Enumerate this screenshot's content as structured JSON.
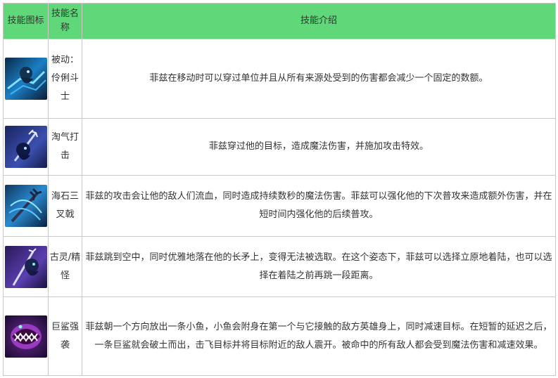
{
  "table": {
    "headers": {
      "icon": "技能图标",
      "name": "技能名称",
      "desc": "技能介绍"
    },
    "rows": [
      {
        "icon": "fizz-passive-icon",
        "name": "被动：伶俐斗士",
        "desc": "菲兹在移动时可以穿过单位并且从所有来源处受到的伤害都会减少一个固定的数额。"
      },
      {
        "icon": "fizz-q-icon",
        "name": "淘气打击",
        "desc": "菲兹穿过他的目标，造成魔法伤害，并施加攻击特效。"
      },
      {
        "icon": "fizz-w-icon",
        "name": "海石三叉戟",
        "desc": "菲兹的攻击会让他的敌人们流血，同时造成持续数秒的魔法伤害。菲兹可以强化他的下次普攻来造成额外伤害，并在短时间内强化他的后续普攻。"
      },
      {
        "icon": "fizz-e-icon",
        "name": "古灵/精怪",
        "desc": "菲兹跳到空中，同时优雅地落在他的长矛上，变得无法被选取。在这个姿态下，菲兹可以选择立原地着陆，也可以选择在着陆之前再跳一段距离。"
      },
      {
        "icon": "fizz-r-icon",
        "name": "巨鲨强袭",
        "desc": "菲兹朝一个方向放出一条小鱼，小鱼会附身在第一个与它接触的敌方英雄身上，同时减速目标。在短暂的延迟之后，一条巨鲨就会破土而出，击飞目标并将目标附近的敌人震开。被命中的所有敌人都会受到魔法伤害和减速效果。"
      }
    ]
  },
  "colors": {
    "header_bg": "#60d779",
    "border": "#c9c9c9",
    "text": "#333333"
  }
}
